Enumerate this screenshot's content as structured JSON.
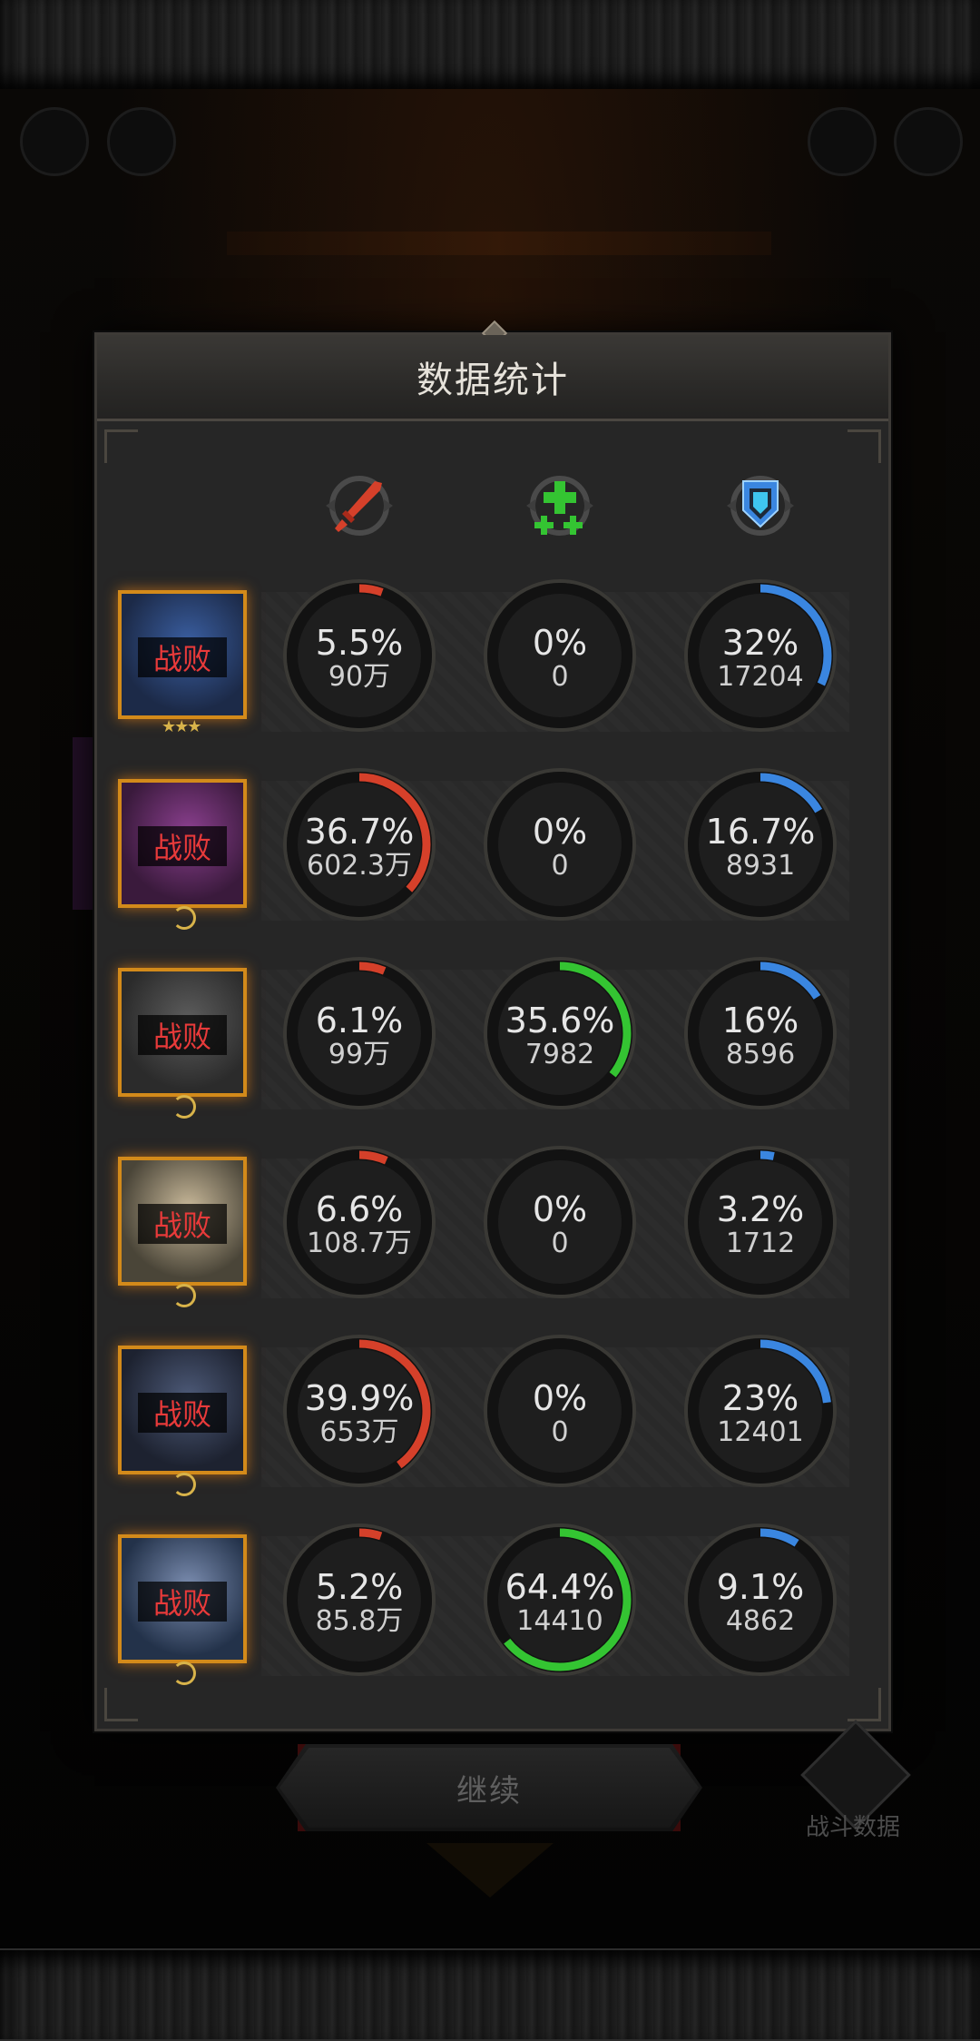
{
  "title": "数据统计",
  "continue_label": "继续",
  "battle_data_label": "战斗数据",
  "columns": [
    {
      "icon": "red-sword-icon",
      "color": "#d5402a"
    },
    {
      "icon": "green-plus-icon",
      "color": "#34c432"
    },
    {
      "icon": "blue-shield-icon",
      "color": "#3a86e0"
    }
  ],
  "heroes": [
    {
      "status": "战败",
      "stars": "★★★",
      "damage": {
        "pct": "5.5%",
        "value": "90万",
        "fraction": 0.055
      },
      "heal": {
        "pct": "0%",
        "value": "0",
        "fraction": 0
      },
      "tank": {
        "pct": "32%",
        "value": "17204",
        "fraction": 0.32
      }
    },
    {
      "status": "战败",
      "damage": {
        "pct": "36.7%",
        "value": "602.3万",
        "fraction": 0.367
      },
      "heal": {
        "pct": "0%",
        "value": "0",
        "fraction": 0
      },
      "tank": {
        "pct": "16.7%",
        "value": "8931",
        "fraction": 0.167
      }
    },
    {
      "status": "战败",
      "damage": {
        "pct": "6.1%",
        "value": "99万",
        "fraction": 0.061
      },
      "heal": {
        "pct": "35.6%",
        "value": "7982",
        "fraction": 0.356
      },
      "tank": {
        "pct": "16%",
        "value": "8596",
        "fraction": 0.16
      }
    },
    {
      "status": "战败",
      "damage": {
        "pct": "6.6%",
        "value": "108.7万",
        "fraction": 0.066
      },
      "heal": {
        "pct": "0%",
        "value": "0",
        "fraction": 0
      },
      "tank": {
        "pct": "3.2%",
        "value": "1712",
        "fraction": 0.032
      }
    },
    {
      "status": "战败",
      "damage": {
        "pct": "39.9%",
        "value": "653万",
        "fraction": 0.399
      },
      "heal": {
        "pct": "0%",
        "value": "0",
        "fraction": 0
      },
      "tank": {
        "pct": "23%",
        "value": "12401",
        "fraction": 0.23
      }
    },
    {
      "status": "战败",
      "damage": {
        "pct": "5.2%",
        "value": "85.8万",
        "fraction": 0.052
      },
      "heal": {
        "pct": "64.4%",
        "value": "14410",
        "fraction": 0.644
      },
      "tank": {
        "pct": "9.1%",
        "value": "4862",
        "fraction": 0.091
      }
    }
  ]
}
